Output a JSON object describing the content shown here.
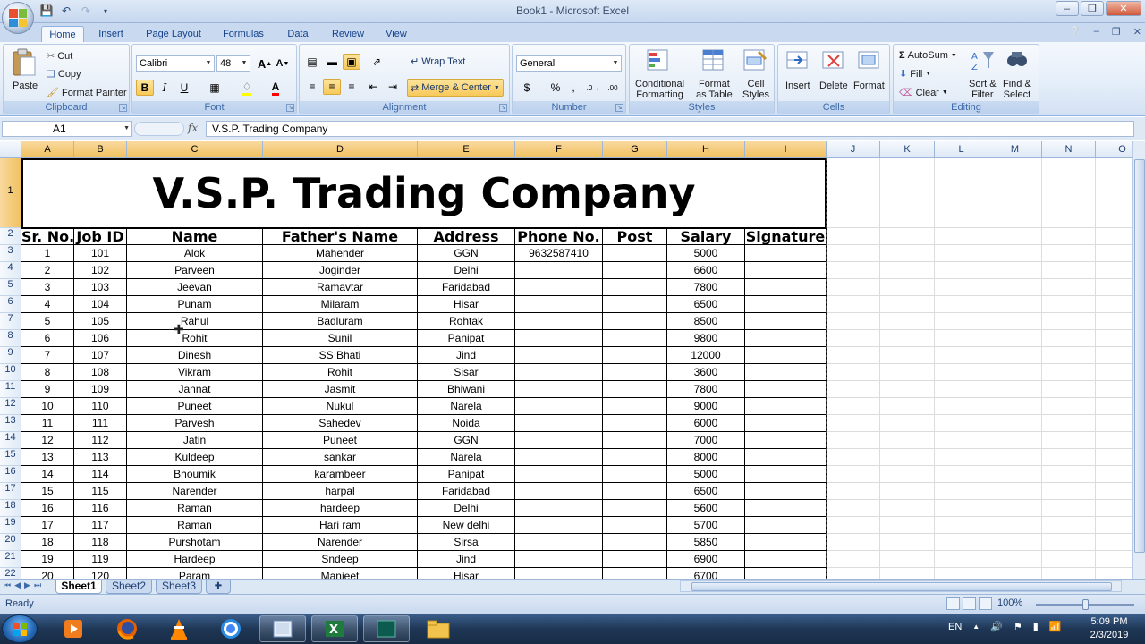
{
  "window": {
    "title": "Book1 - Microsoft Excel"
  },
  "ribbon": {
    "tabs": [
      "Home",
      "Insert",
      "Page Layout",
      "Formulas",
      "Data",
      "Review",
      "View"
    ],
    "clipboard": {
      "paste": "Paste",
      "cut": "Cut",
      "copy": "Copy",
      "format_painter": "Format Painter",
      "label": "Clipboard"
    },
    "font": {
      "name": "Calibri",
      "size": "48",
      "label": "Font"
    },
    "alignment": {
      "wrap_text": "Wrap Text",
      "merge_center": "Merge & Center",
      "label": "Alignment"
    },
    "number": {
      "format": "General",
      "label": "Number"
    },
    "styles": {
      "conditional": "Conditional",
      "conditional2": "Formatting",
      "format_table": "Format",
      "format_table2": "as Table",
      "cell_styles": "Cell",
      "cell_styles2": "Styles",
      "label": "Styles"
    },
    "cells": {
      "insert": "Insert",
      "delete": "Delete",
      "format": "Format",
      "label": "Cells"
    },
    "editing": {
      "autosum": "AutoSum",
      "fill": "Fill",
      "clear": "Clear",
      "sort": "Sort &",
      "sort2": "Filter",
      "find": "Find &",
      "find2": "Select",
      "label": "Editing"
    }
  },
  "formula_bar": {
    "name_box": "A1",
    "fx": "fx",
    "content": "V.S.P. Trading Company"
  },
  "columns": [
    "A",
    "B",
    "C",
    "D",
    "E",
    "F",
    "G",
    "H",
    "I",
    "J",
    "K",
    "L",
    "M",
    "N",
    "O"
  ],
  "rows": [
    "1",
    "2",
    "3",
    "4",
    "5",
    "6",
    "7",
    "8",
    "9",
    "10",
    "11",
    "12",
    "13",
    "14",
    "15",
    "16",
    "17",
    "18",
    "19",
    "20",
    "21",
    "22"
  ],
  "sheet": {
    "title": "V.S.P. Trading Company",
    "headers": [
      "Sr. No.",
      "Job ID",
      "Name",
      "Father's Name",
      "Address",
      "Phone No.",
      "Post",
      "Salary",
      "Signature"
    ],
    "data": [
      [
        "1",
        "101",
        "Alok",
        "Mahender",
        "GGN",
        "9632587410",
        "",
        "5000",
        ""
      ],
      [
        "2",
        "102",
        "Parveen",
        "Joginder",
        "Delhi",
        "",
        "",
        "6600",
        ""
      ],
      [
        "3",
        "103",
        "Jeevan",
        "Ramavtar",
        "Faridabad",
        "",
        "",
        "7800",
        ""
      ],
      [
        "4",
        "104",
        "Punam",
        "Milaram",
        "Hisar",
        "",
        "",
        "6500",
        ""
      ],
      [
        "5",
        "105",
        "Rahul",
        "Badluram",
        "Rohtak",
        "",
        "",
        "8500",
        ""
      ],
      [
        "6",
        "106",
        "Rohit",
        "Sunil",
        "Panipat",
        "",
        "",
        "9800",
        ""
      ],
      [
        "7",
        "107",
        "Dinesh",
        "SS Bhati",
        "Jind",
        "",
        "",
        "12000",
        ""
      ],
      [
        "8",
        "108",
        "Vikram",
        "Rohit",
        "Sisar",
        "",
        "",
        "3600",
        ""
      ],
      [
        "9",
        "109",
        "Jannat",
        "Jasmit",
        "Bhiwani",
        "",
        "",
        "7800",
        ""
      ],
      [
        "10",
        "110",
        "Puneet",
        "Nukul",
        "Narela",
        "",
        "",
        "9000",
        ""
      ],
      [
        "11",
        "111",
        "Parvesh",
        "Sahedev",
        "Noida",
        "",
        "",
        "6000",
        ""
      ],
      [
        "12",
        "112",
        "Jatin",
        "Puneet",
        "GGN",
        "",
        "",
        "7000",
        ""
      ],
      [
        "13",
        "113",
        "Kuldeep",
        "sankar",
        "Narela",
        "",
        "",
        "8000",
        ""
      ],
      [
        "14",
        "114",
        "Bhoumik",
        "karambeer",
        "Panipat",
        "",
        "",
        "5000",
        ""
      ],
      [
        "15",
        "115",
        "Narender",
        "harpal",
        "Faridabad",
        "",
        "",
        "6500",
        ""
      ],
      [
        "16",
        "116",
        "Raman",
        "hardeep",
        "Delhi",
        "",
        "",
        "5600",
        ""
      ],
      [
        "17",
        "117",
        "Raman",
        "Hari ram",
        "New delhi",
        "",
        "",
        "5700",
        ""
      ],
      [
        "18",
        "118",
        "Purshotam",
        "Narender",
        "Sirsa",
        "",
        "",
        "5850",
        ""
      ],
      [
        "19",
        "119",
        "Hardeep",
        "Sndeep",
        "Jind",
        "",
        "",
        "6900",
        ""
      ],
      [
        "20",
        "120",
        "Param",
        "Manjeet",
        "Hisar",
        "",
        "",
        "6700",
        ""
      ]
    ]
  },
  "sheet_tabs": [
    "Sheet1",
    "Sheet2",
    "Sheet3"
  ],
  "status": {
    "text": "Ready",
    "zoom": "100%"
  },
  "taskbar": {
    "lang": "EN",
    "time": "5:09 PM",
    "date": "2/3/2019"
  },
  "icons": {
    "save": "save-icon",
    "undo": "undo-icon",
    "redo": "redo-icon",
    "bold": "B",
    "italic": "I",
    "underline": "U",
    "sum": "Σ"
  },
  "colors": {
    "selection": "#f1c15f",
    "ribbon_text": "#15428b",
    "excel_green": "#1f7a3e"
  }
}
